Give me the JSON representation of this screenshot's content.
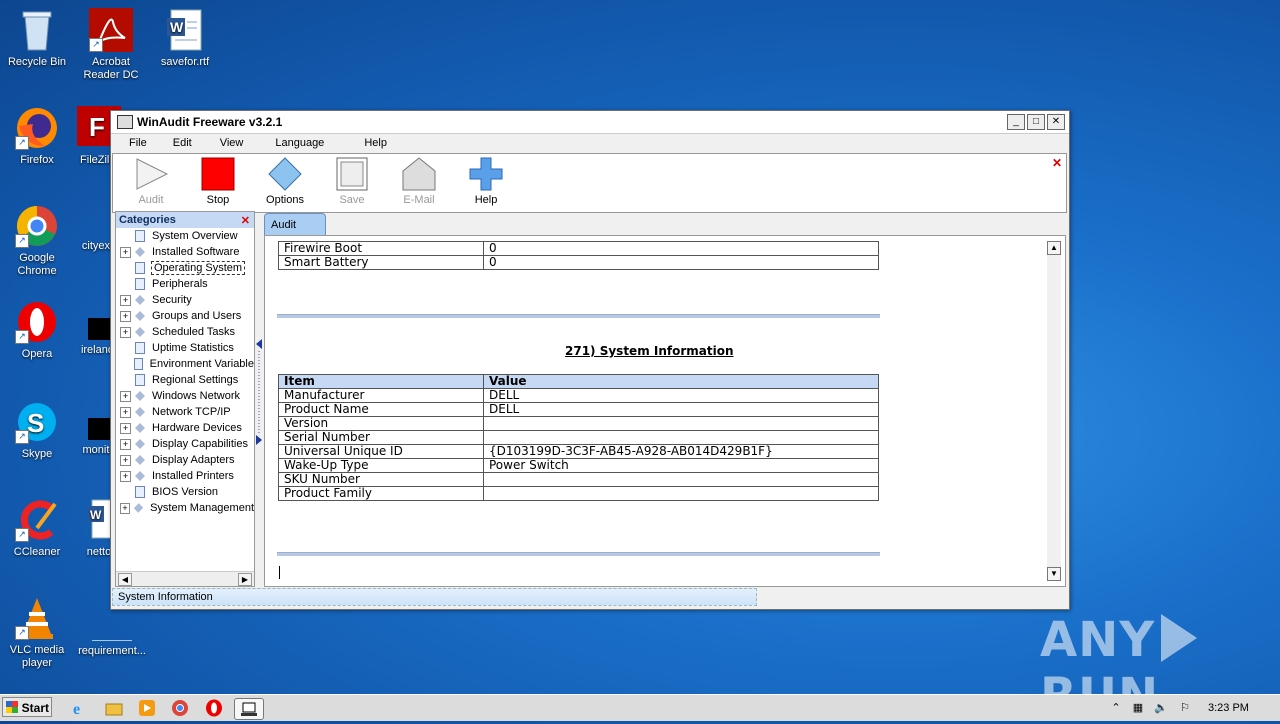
{
  "desktop": {
    "icons": [
      {
        "label": "Recycle Bin"
      },
      {
        "label": "Acrobat Reader DC"
      },
      {
        "label": "savefor.rtf"
      },
      {
        "label": "Firefox"
      },
      {
        "label": "FileZilla"
      },
      {
        "label": "Google Chrome"
      },
      {
        "label": "cityexp"
      },
      {
        "label": "Opera"
      },
      {
        "label": "irelandt"
      },
      {
        "label": "Skype"
      },
      {
        "label": "monito"
      },
      {
        "label": "CCleaner"
      },
      {
        "label": "netto"
      },
      {
        "label": "VLC media player"
      },
      {
        "label": "requirement..."
      }
    ],
    "watermark": {
      "left": "ANY",
      "right": "RUN"
    }
  },
  "window": {
    "title": "WinAudit Freeware v3.2.1",
    "controls": {
      "minimize": "_",
      "maximize": "□",
      "close": "✕"
    },
    "menu": [
      "File",
      "Edit",
      "View",
      "Language",
      "Help"
    ],
    "toolbar": [
      {
        "label": "Audit",
        "icon": "play-icon",
        "enabled": false
      },
      {
        "label": "Stop",
        "icon": "stop-icon",
        "enabled": true
      },
      {
        "label": "Options",
        "icon": "diamond-icon",
        "enabled": true
      },
      {
        "label": "Save",
        "icon": "save-icon",
        "enabled": false
      },
      {
        "label": "E-Mail",
        "icon": "email-icon",
        "enabled": false
      },
      {
        "label": "Help",
        "icon": "help-plus-icon",
        "enabled": true
      }
    ],
    "toolbar_close": "✕",
    "categories": {
      "title": "Categories",
      "close": "✕",
      "items": [
        {
          "label": "System Overview",
          "expandable": false,
          "icon": "doc"
        },
        {
          "label": "Installed Software",
          "expandable": true,
          "icon": "dia"
        },
        {
          "label": "Operating System",
          "expandable": false,
          "icon": "doc",
          "selected": true
        },
        {
          "label": "Peripherals",
          "expandable": false,
          "icon": "doc"
        },
        {
          "label": "Security",
          "expandable": true,
          "icon": "dia"
        },
        {
          "label": "Groups and Users",
          "expandable": true,
          "icon": "dia"
        },
        {
          "label": "Scheduled Tasks",
          "expandable": true,
          "icon": "dia"
        },
        {
          "label": "Uptime Statistics",
          "expandable": false,
          "icon": "doc"
        },
        {
          "label": "Environment Variable",
          "expandable": false,
          "icon": "doc"
        },
        {
          "label": "Regional Settings",
          "expandable": false,
          "icon": "doc"
        },
        {
          "label": "Windows Network",
          "expandable": true,
          "icon": "dia"
        },
        {
          "label": "Network TCP/IP",
          "expandable": true,
          "icon": "dia"
        },
        {
          "label": "Hardware Devices",
          "expandable": true,
          "icon": "dia"
        },
        {
          "label": "Display Capabilities",
          "expandable": true,
          "icon": "dia"
        },
        {
          "label": "Display Adapters",
          "expandable": true,
          "icon": "dia"
        },
        {
          "label": "Installed Printers",
          "expandable": true,
          "icon": "dia"
        },
        {
          "label": "BIOS Version",
          "expandable": false,
          "icon": "doc"
        },
        {
          "label": "System Management",
          "expandable": true,
          "icon": "dia"
        }
      ]
    },
    "tab": "Audit",
    "content": {
      "top_rows": [
        [
          "Firewire Boot",
          "0"
        ],
        [
          "Smart Battery",
          "0"
        ]
      ],
      "section_title": "271) System Information",
      "table_header": [
        "Item",
        "Value"
      ],
      "rows": [
        [
          "Manufacturer",
          "DELL"
        ],
        [
          "Product Name",
          "DELL"
        ],
        [
          "Version",
          ""
        ],
        [
          "Serial Number",
          ""
        ],
        [
          "Universal Unique ID",
          "{D103199D-3C3F-AB45-A928-AB014D429B1F}"
        ],
        [
          "Wake-Up Type",
          "Power Switch"
        ],
        [
          "SKU Number",
          ""
        ],
        [
          "Product Family",
          ""
        ]
      ]
    },
    "status": "System Information"
  },
  "taskbar": {
    "start": "Start",
    "clock": "3:23 PM"
  }
}
